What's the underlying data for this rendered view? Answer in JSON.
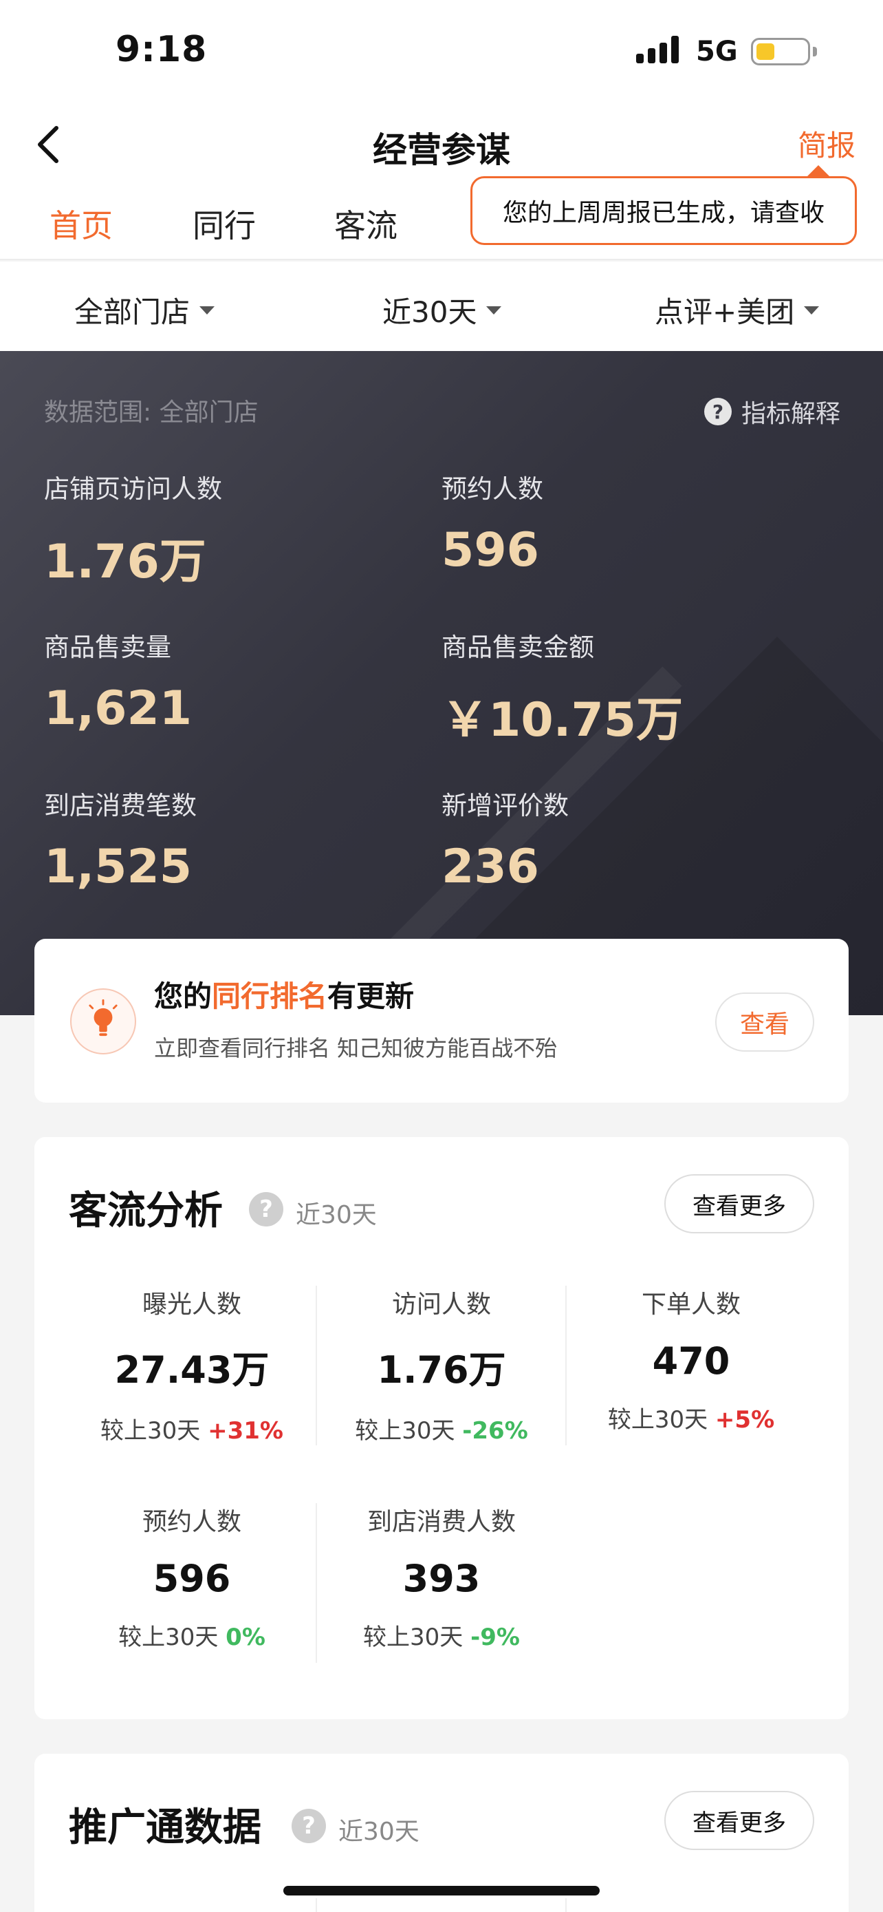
{
  "status": {
    "time": "9:18",
    "network": "5G"
  },
  "nav": {
    "title": "经营参谋",
    "brief": "简报"
  },
  "tabs": [
    {
      "label": "首页",
      "active": true
    },
    {
      "label": "同行",
      "active": false
    },
    {
      "label": "客流",
      "active": false
    }
  ],
  "tooltip": "您的上周周报已生成，请查收",
  "filters": {
    "store": "全部门店",
    "period": "近30天",
    "platform": "点评+美团"
  },
  "hero": {
    "scope": "数据范围: 全部门店",
    "explain": "指标解释",
    "metrics": [
      {
        "label": "店铺页访问人数",
        "value": "1.76万"
      },
      {
        "label": "预约人数",
        "value": "596"
      },
      {
        "label": "商品售卖量",
        "value": "1,621"
      },
      {
        "label": "商品售卖金额",
        "value": "￥10.75万"
      },
      {
        "label": "到店消费笔数",
        "value": "1,525"
      },
      {
        "label": "新增评价数",
        "value": "236"
      }
    ]
  },
  "rank": {
    "title_pre": "您的",
    "title_hl": "同行排名",
    "title_post": "有更新",
    "subtitle": "立即查看同行排名 知己知彼方能百战不殆",
    "button": "查看"
  },
  "traffic": {
    "title": "客流分析",
    "period": "近30天",
    "more": "查看更多",
    "items": [
      {
        "label": "曝光人数",
        "value": "27.43万",
        "cmp": "较上30天",
        "change": "+31%",
        "dir": "up"
      },
      {
        "label": "访问人数",
        "value": "1.76万",
        "cmp": "较上30天",
        "change": "-26%",
        "dir": "down"
      },
      {
        "label": "下单人数",
        "value": "470",
        "cmp": "较上30天",
        "change": "+5%",
        "dir": "up"
      },
      {
        "label": "预约人数",
        "value": "596",
        "cmp": "较上30天",
        "change": "0%",
        "dir": "down"
      },
      {
        "label": "到店消费人数",
        "value": "393",
        "cmp": "较上30天",
        "change": "-9%",
        "dir": "down"
      }
    ]
  },
  "promo": {
    "title": "推广通数据",
    "period": "近30天",
    "more": "查看更多"
  },
  "colors": {
    "accent": "#f26a2e",
    "up": "#e03131",
    "down": "#40b95f",
    "hero_value": "#f1d6ad"
  }
}
